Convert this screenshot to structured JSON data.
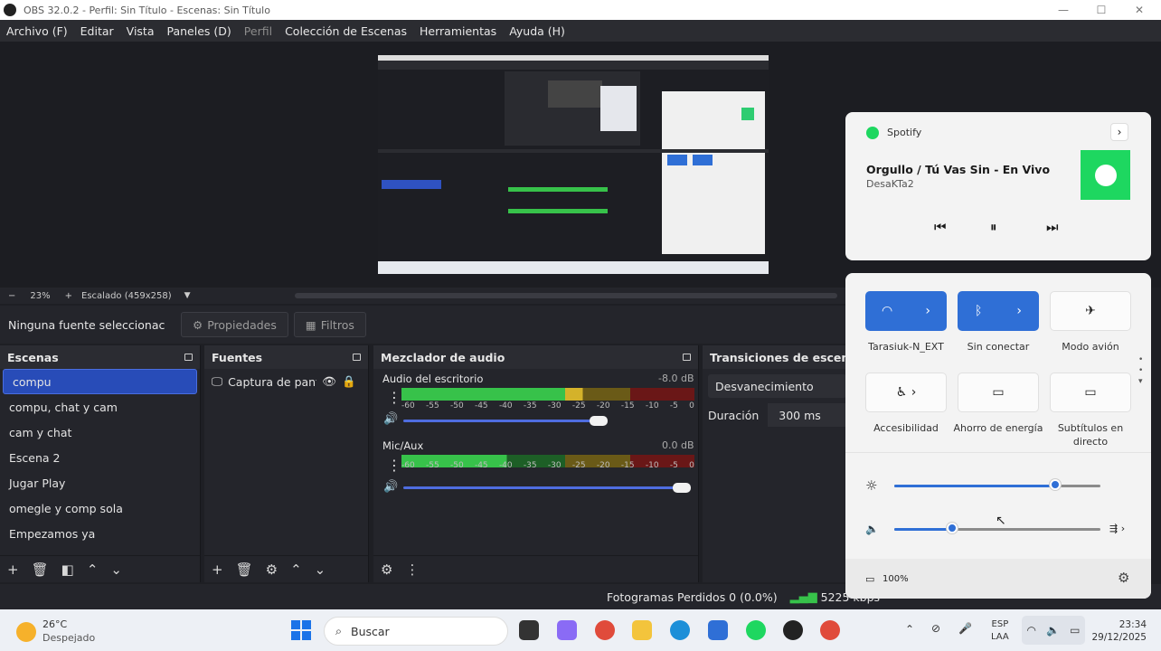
{
  "window": {
    "title": "OBS 32.0.2 - Perfil: Sin Título - Escenas: Sin Título",
    "minimize": "—",
    "maximize": "☐",
    "close": "✕"
  },
  "menu": [
    "Archivo (F)",
    "Editar",
    "Vista",
    "Paneles (D)",
    "Perfil",
    "Colección de Escenas",
    "Herramientas",
    "Ayuda (H)"
  ],
  "zoom": {
    "minus": "−",
    "value": "23%",
    "plus": "+",
    "scaling": "Escalado (459x258)"
  },
  "source_bar": {
    "no_selection": "Ninguna fuente seleccionac",
    "properties": "Propiedades",
    "filters": "Filtros"
  },
  "scenes": {
    "title": "Escenas",
    "items": [
      "compu",
      "compu, chat y cam",
      "cam y chat",
      "Escena 2",
      "Jugar Play",
      "omegle y comp sola",
      "Empezamos ya"
    ],
    "selected": 0
  },
  "sources": {
    "title": "Fuentes",
    "items": [
      {
        "name": "Captura de panta"
      }
    ]
  },
  "mixer": {
    "title": "Mezclador de audio",
    "channels": [
      {
        "name": "Audio del escritorio",
        "db": "-8.0 dB",
        "level": 0.62,
        "volume": 0.68
      },
      {
        "name": "Mic/Aux",
        "db": "0.0 dB",
        "level": 0.36,
        "volume": 0.97
      }
    ],
    "ticks": [
      "-60",
      "-55",
      "-50",
      "-45",
      "-40",
      "-35",
      "-30",
      "-25",
      "-20",
      "-15",
      "-10",
      "-5",
      "0"
    ]
  },
  "transitions": {
    "title": "Transiciones de escena",
    "type": "Desvanecimiento",
    "duration_label": "Duración",
    "duration": "300 ms"
  },
  "status": {
    "frames": "Fotogramas Perdidos 0 (0.0%)",
    "bitrate": "5225 kbps"
  },
  "spotify": {
    "app": "Spotify",
    "track": "Orgullo / Tú Vas Sin - En Vivo",
    "artist": "DesaKTa2"
  },
  "quick_settings": {
    "tiles": [
      {
        "label": "Tarasiuk-N_EXT",
        "active": true
      },
      {
        "label": "Sin conectar",
        "active": true
      },
      {
        "label": "Modo avión",
        "active": false
      },
      {
        "label": "Accesibilidad",
        "active": false
      },
      {
        "label": "Ahorro de energía",
        "active": false
      },
      {
        "label": "Subtítulos en directo",
        "active": false
      }
    ],
    "brightness": 0.78,
    "volume": 0.28,
    "battery": "100%"
  },
  "taskbar": {
    "weather_temp": "26°C",
    "weather_desc": "Despejado",
    "search": "Buscar",
    "lang1": "ESP",
    "lang2": "LAA",
    "time": "23:34",
    "date": "29/12/2025"
  },
  "colors": {
    "accent": "#2f6fd6",
    "meter_green": "#37c24a",
    "spotify_green": "#1ed760",
    "selection": "#284cb8"
  }
}
